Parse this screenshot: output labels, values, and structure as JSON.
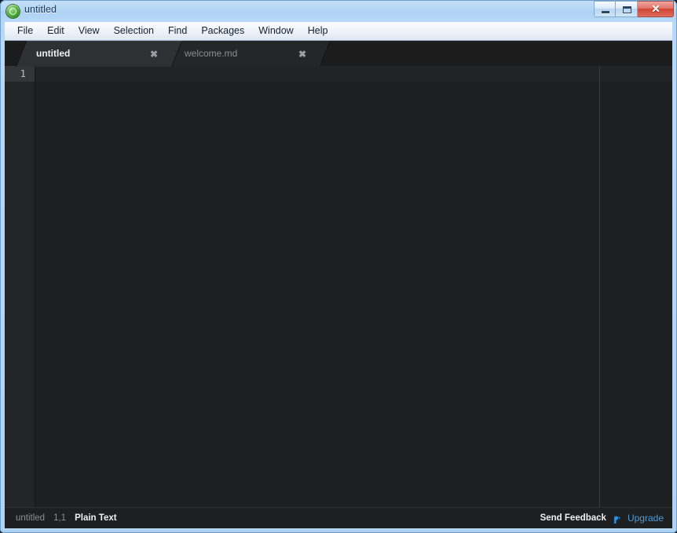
{
  "window": {
    "title": "untitled",
    "app_icon": "atom-icon",
    "controls": {
      "minimize_label": "minimize-icon",
      "maximize_label": "maximize-icon",
      "close_label": "✕"
    },
    "frame_color": "#b4d6f5",
    "border_color": "#6f9fc8"
  },
  "menubar": {
    "items": [
      {
        "label": "File"
      },
      {
        "label": "Edit"
      },
      {
        "label": "View"
      },
      {
        "label": "Selection"
      },
      {
        "label": "Find"
      },
      {
        "label": "Packages"
      },
      {
        "label": "Window"
      },
      {
        "label": "Help"
      }
    ]
  },
  "tabs": [
    {
      "label": "untitled",
      "active": true,
      "close_label": "✖"
    },
    {
      "label": "welcome.md",
      "active": false,
      "close_label": "✖"
    }
  ],
  "editor": {
    "background": "#1d1f21",
    "gutter_background": "#222426",
    "active_line_background": "#333638",
    "wrap_guide_color": "#3a3d40",
    "lines": [
      {
        "number": "1",
        "text": ""
      }
    ],
    "content": ""
  },
  "statusbar": {
    "file_name": "untitled",
    "cursor_position": "1,1",
    "grammar": "Plain Text",
    "feedback_label": "Send Feedback",
    "upgrade_label": "Upgrade",
    "upgrade_icon": "squirrel-icon",
    "upgrade_color": "#4f9bd8"
  }
}
